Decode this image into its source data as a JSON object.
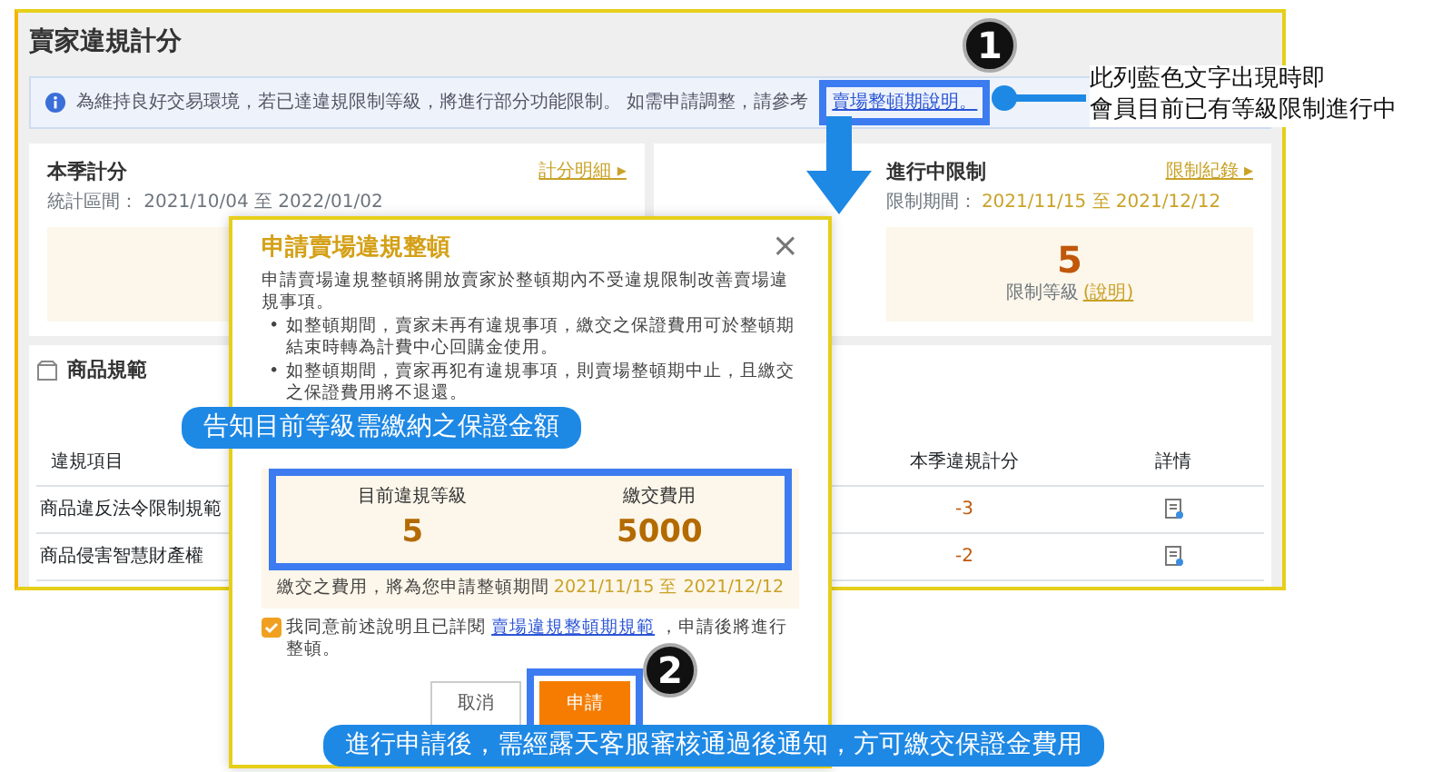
{
  "page": {
    "title": "賣家違規計分"
  },
  "notice": {
    "text": "為維持良好交易環境，若已達違規限制等級，將進行部分功能限制。 如需申請調整，請參考",
    "link": "賣場整頓期說明。"
  },
  "score_card": {
    "title": "本季計分",
    "link": "計分明細 ▸",
    "period": "統計區間： 2021/10/04 至 2022/01/02"
  },
  "restriction_card": {
    "title": "進行中限制",
    "link": "限制紀錄 ▸",
    "period_label": "限制期間：",
    "period": "2021/11/15 至 2021/12/12",
    "level": "5",
    "level_label": "限制等級",
    "help_link": "(說明)"
  },
  "rules_section": {
    "title": "商品規範",
    "columns": [
      "違規項目",
      "本季違規計分",
      "詳情"
    ],
    "rows": [
      {
        "item": "商品違反法令限制規範",
        "score": "-3"
      },
      {
        "item": "商品侵害智慧財產權",
        "score": "-2"
      }
    ]
  },
  "dialog": {
    "title": "申請賣場違規整頓",
    "close": "×",
    "bullet_marker": "•",
    "intro": "申請賣場違規整頓將開放賣家於整頓期內不受違規限制改善賣場違規事項。",
    "bullets": [
      "如整頓期間，賣家未再有違規事項，繳交之保證費用可於整頓期結束時轉為計費中心回購金使用。",
      "如整頓期間，賣家再犯有違規事項，則賣場整頓期中止，且繳交之保證費用將不退還。"
    ],
    "fee": {
      "level_label": "目前違規等級",
      "level": "5",
      "fee_label": "繳交費用",
      "fee": "5000",
      "note": "繳交之費用，將為您申請整頓期間",
      "period": "2021/11/15 至 2021/12/12"
    },
    "agreement": {
      "checked": true,
      "text": "我同意前述說明且已詳閱",
      "link": "賣場違規整頓期規範",
      "after": "，申請後將進行整頓。"
    },
    "buttons": [
      {
        "label": "取消",
        "kind": "secondary"
      },
      {
        "label": "申請",
        "kind": "primary"
      }
    ]
  },
  "annotations": [
    {
      "kind": "marker",
      "text": "1"
    },
    {
      "kind": "note",
      "lines": [
        "此列藍色文字出現時即",
        "會員目前已有等級限制進行中"
      ]
    },
    {
      "kind": "banner",
      "text": "告知目前等級需繳納之保證金額"
    },
    {
      "kind": "marker",
      "text": "2"
    },
    {
      "kind": "banner",
      "text": "進行申請後，需經露天客服審核通過後通知，方可繳交保證金費用"
    }
  ]
}
